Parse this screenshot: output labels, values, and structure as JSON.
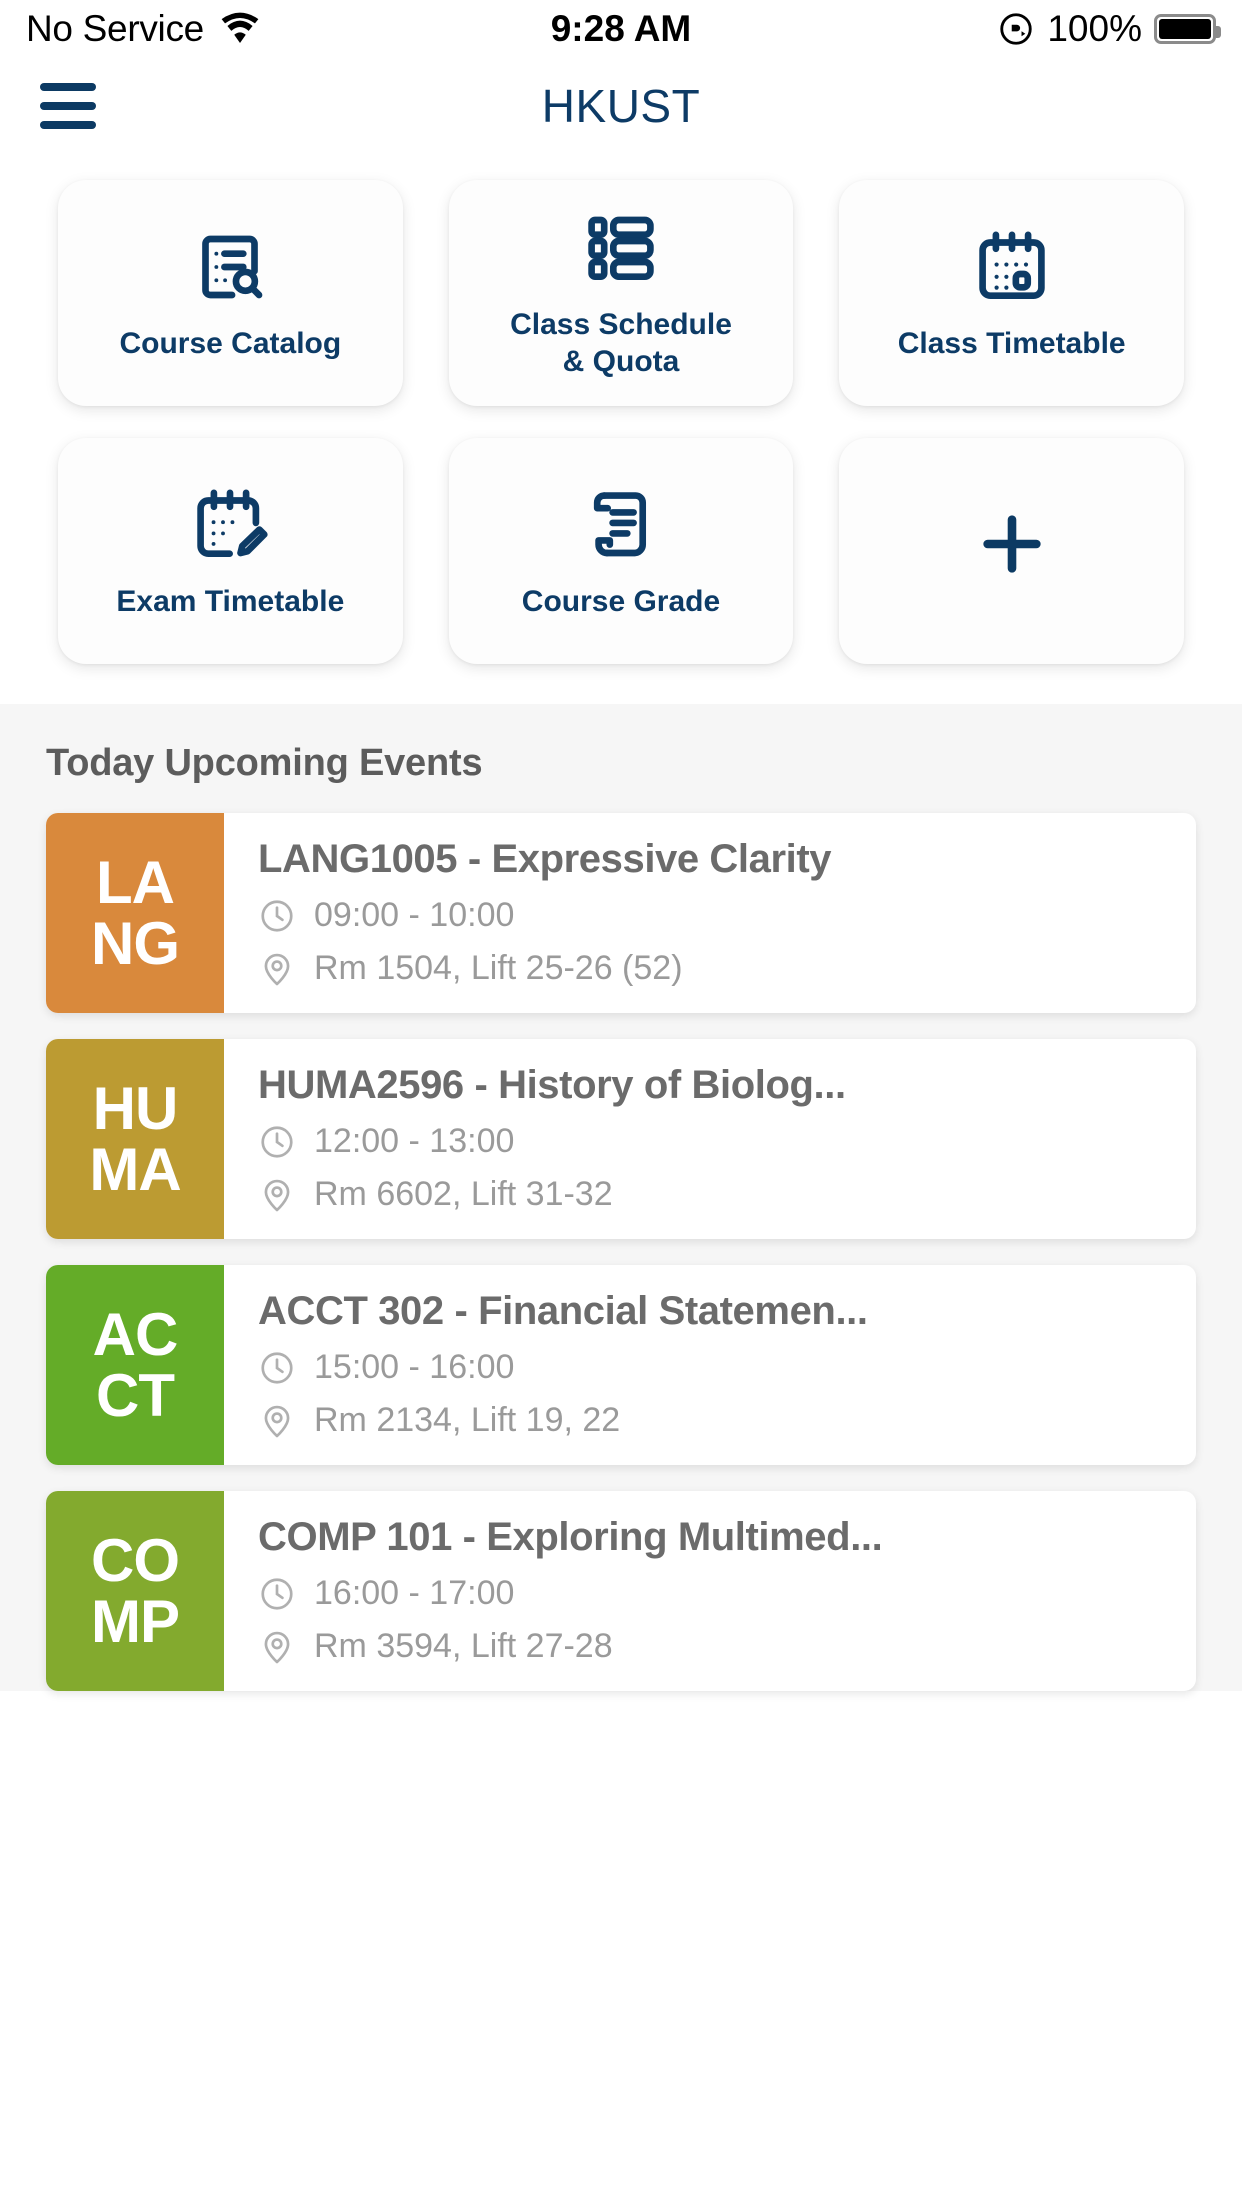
{
  "statusbar": {
    "carrier": "No Service",
    "wifi_icon": "wifi-icon",
    "time": "9:28 AM",
    "rotation_lock_icon": "rotation-lock-icon",
    "battery_percent": "100%",
    "battery_icon": "battery-full-icon"
  },
  "navbar": {
    "menu_icon": "hamburger-menu-icon",
    "title": "HKUST"
  },
  "quick_actions": [
    {
      "label": "Course Catalog",
      "icon": "document-search-icon"
    },
    {
      "label": "Class Schedule\n& Quota",
      "label_line1": "Class Schedule",
      "label_line2": "& Quota",
      "icon": "list-blocks-icon"
    },
    {
      "label": "Class Timetable",
      "icon": "calendar-icon"
    },
    {
      "label": "Exam Timetable",
      "icon": "calendar-edit-icon"
    },
    {
      "label": "Course Grade",
      "icon": "scroll-certificate-icon"
    },
    {
      "label": "",
      "icon": "plus-icon",
      "is_add": true
    }
  ],
  "events_section": {
    "title": "Today Upcoming Events",
    "clock_icon": "clock-icon",
    "location_icon": "location-pin-icon"
  },
  "events": [
    {
      "tag_line1": "LA",
      "tag_line2": "NG",
      "tag_color": "#d9893c",
      "name": "LANG1005 - Expressive Clarity",
      "time": "09:00 - 10:00",
      "location": "Rm 1504, Lift 25-26 (52)"
    },
    {
      "tag_line1": "HU",
      "tag_line2": "MA",
      "tag_color": "#bc9b32",
      "name": "HUMA2596 - History of Biolog...",
      "time": "12:00 - 13:00",
      "location": "Rm 6602, Lift 31-32"
    },
    {
      "tag_line1": "AC",
      "tag_line2": "CT",
      "tag_color": "#64ac28",
      "name": "ACCT 302 - Financial Statemen...",
      "time": "15:00 - 16:00",
      "location": "Rm 2134, Lift 19, 22"
    },
    {
      "tag_line1": "CO",
      "tag_line2": "MP",
      "tag_color": "#83aa2e",
      "name": "COMP 101 - Exploring Multimed...",
      "time": "16:00 - 17:00",
      "location": "Rm 3594, Lift 27-28"
    }
  ],
  "colors": {
    "brand_navy": "#0d3b66",
    "events_bg": "#f6f6f6",
    "text_gray": "#6b6b6b",
    "muted_gray": "#9a9a9a"
  }
}
